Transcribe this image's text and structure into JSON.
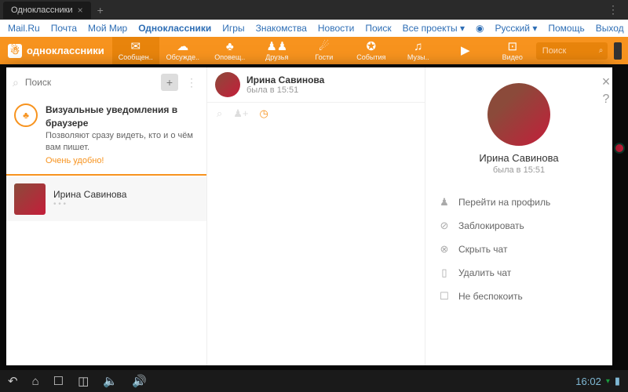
{
  "tab": {
    "title": "Одноклассники"
  },
  "links": {
    "mailru": "Mail.Ru",
    "pochta": "Почта",
    "moimir": "Мой Мир",
    "ok": "Одноклассники",
    "games": "Игры",
    "znak": "Знакомства",
    "news": "Новости",
    "search": "Поиск",
    "projects": "Все проекты ▾",
    "lang": "Русский ▾",
    "help": "Помощь",
    "exit": "Выход"
  },
  "brand": "одноклассники",
  "nav": {
    "msg": "Сообщен..",
    "disc": "Обсужде..",
    "notif": "Оповещ..",
    "friends": "Друзья",
    "guests": "Гости",
    "events": "События",
    "music": "Музы..",
    "video": "Видео",
    "searchPlaceholder": "Поиск"
  },
  "left": {
    "searchPlaceholder": "Поиск",
    "notifTitle": "Визуальные уведомления в браузере",
    "notifBody": "Позволяют сразу видеть, кто и о чём вам пишет.",
    "notifSub": "Очень удобно!",
    "chatName": "Ирина Савинова"
  },
  "header": {
    "name": "Ирина Савинова",
    "status": "была в 15:51"
  },
  "profile": {
    "name": "Ирина Савинова",
    "status": "была в 15:51",
    "actions": {
      "profile": "Перейти на профиль",
      "block": "Заблокировать",
      "hide": "Скрыть чат",
      "delete": "Удалить чат",
      "dnd": "Не беспокоить"
    }
  },
  "time": "16:02"
}
